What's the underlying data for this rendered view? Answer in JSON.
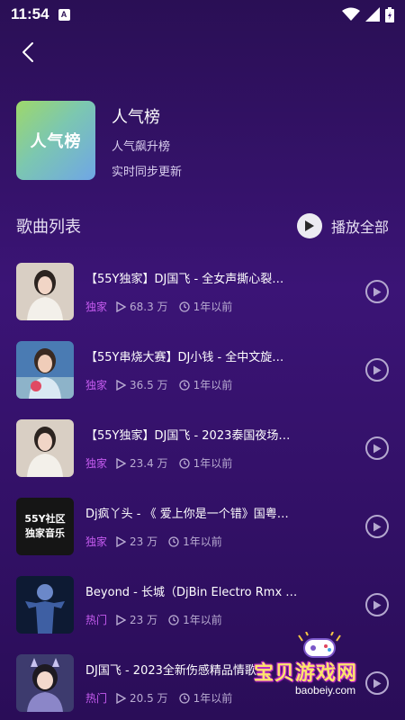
{
  "status": {
    "time": "11:54",
    "a_label": "A"
  },
  "hero": {
    "cover_text": "人气榜",
    "title": "人气榜",
    "subtitle": "人气飙升榜",
    "update": "实时同步更新"
  },
  "list_header": {
    "title": "歌曲列表",
    "play_all": "播放全部"
  },
  "songs": [
    {
      "title": "【55Y独家】DJ国飞 - 全女声撕心裂…",
      "tag": "独家",
      "plays": "68.3 万",
      "time": "1年以前",
      "thumb": "photo"
    },
    {
      "title": "【55Y串烧大赛】DJ小钱 - 全中文旋…",
      "tag": "独家",
      "plays": "36.5 万",
      "time": "1年以前",
      "thumb": "photo"
    },
    {
      "title": "【55Y独家】DJ国飞 - 2023泰国夜场…",
      "tag": "独家",
      "plays": "23.4 万",
      "time": "1年以前",
      "thumb": "photo"
    },
    {
      "title": "Dj疯丫头 - 《 爱上你是一个错》国粤…",
      "tag": "独家",
      "plays": "23 万",
      "time": "1年以前",
      "thumb": "text",
      "thumb_line1": "55Y社区",
      "thumb_line2": "独家音乐"
    },
    {
      "title": "Beyond - 长城（DjBin Electro Rmx …",
      "tag": "热门",
      "plays": "23 万",
      "time": "1年以前",
      "thumb": "photo"
    },
    {
      "title": "DJ国飞 - 2023全新伤感精品情歌…",
      "tag": "热门",
      "plays": "20.5 万",
      "time": "1年以前",
      "thumb": "photo"
    }
  ],
  "watermark": {
    "text": "宝贝游戏网",
    "url": "baobeiy.com"
  },
  "colors": {
    "accent": "#c65cf0",
    "bg_top": "#2a0f55",
    "bg_mid": "#3b1476"
  },
  "icons": [
    "back-arrow-icon",
    "wifi-icon",
    "signal-icon",
    "battery-icon",
    "play-icon",
    "play-count-icon",
    "clock-icon"
  ]
}
